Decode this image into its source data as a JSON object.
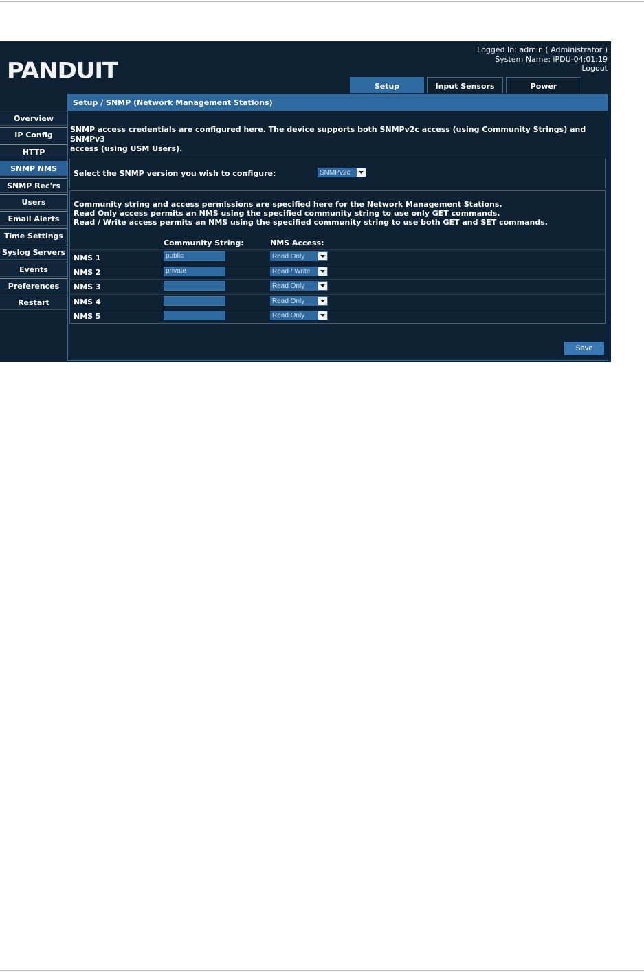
{
  "header": {
    "logo_text": "PANDUIT",
    "logged_in": "Logged In: admin ( Administrator )",
    "system_name": "System Name: iPDU-04:01:19",
    "logout": "Logout"
  },
  "tabs": [
    {
      "label": "Setup",
      "active": true
    },
    {
      "label": "Input Sensors",
      "active": false
    },
    {
      "label": "Power",
      "active": false
    }
  ],
  "sidebar": {
    "items": [
      {
        "label": "Overview",
        "active": false
      },
      {
        "label": "IP Config",
        "active": false
      },
      {
        "label": "HTTP",
        "active": false
      },
      {
        "label": "SNMP NMS",
        "active": true
      },
      {
        "label": "SNMP Rec'rs",
        "active": false
      },
      {
        "label": "Users",
        "active": false
      },
      {
        "label": "Email Alerts",
        "active": false
      },
      {
        "label": "Time Settings",
        "active": false
      },
      {
        "label": "Syslog Servers",
        "active": false
      },
      {
        "label": "Events",
        "active": false
      },
      {
        "label": "Preferences",
        "active": false
      },
      {
        "label": "Restart",
        "active": false
      }
    ]
  },
  "main": {
    "title": "Setup / SNMP (Network Management Stations)",
    "intro_line1": "SNMP access credentials are configured here. The device supports both SNMPv2c access (using Community Strings) and SNMPv3",
    "intro_line2": "access (using USM Users).",
    "version_label": "Select the SNMP version you wish to configure:",
    "version_value": "SNMPv2c",
    "nms_desc_line1": "Community string and access permissions are specified here for the Network Management Stations.",
    "nms_desc_line2": "Read Only access permits an NMS using the specified community string to use only GET commands.",
    "nms_desc_line3": "Read / Write access permits an NMS using the specified community string to use both GET and SET commands.",
    "col_community": "Community String:",
    "col_access": "NMS Access:",
    "rows": [
      {
        "label": "NMS 1",
        "community": "public",
        "access": "Read Only"
      },
      {
        "label": "NMS 2",
        "community": "private",
        "access": "Read / Write"
      },
      {
        "label": "NMS 3",
        "community": "",
        "access": "Read Only"
      },
      {
        "label": "NMS 4",
        "community": "",
        "access": "Read Only"
      },
      {
        "label": "NMS 5",
        "community": "",
        "access": "Read Only"
      }
    ],
    "save_label": "Save"
  },
  "colors": {
    "background": "#0f2234",
    "accent": "#2e6aa0",
    "button": "#3a78b5"
  },
  "icons": {
    "dropdown": "chevron-down-icon"
  }
}
